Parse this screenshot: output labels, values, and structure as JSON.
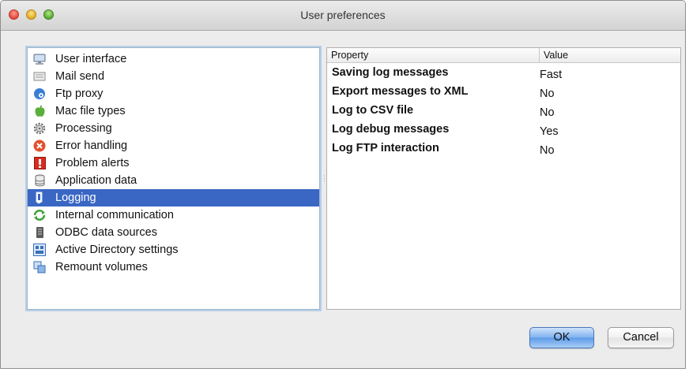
{
  "window": {
    "title": "User preferences"
  },
  "sidebar": {
    "items": [
      {
        "label": "User interface",
        "icon": "monitor-icon"
      },
      {
        "label": "Mail send",
        "icon": "mail-tray-icon"
      },
      {
        "label": "Ftp proxy",
        "icon": "globe-icon"
      },
      {
        "label": "Mac file types",
        "icon": "apple-icon"
      },
      {
        "label": "Processing",
        "icon": "gear-icon"
      },
      {
        "label": "Error handling",
        "icon": "error-icon"
      },
      {
        "label": "Problem alerts",
        "icon": "alert-icon"
      },
      {
        "label": "Application data",
        "icon": "database-icon"
      },
      {
        "label": "Logging",
        "icon": "log-icon",
        "selected": true
      },
      {
        "label": "Internal communication",
        "icon": "sync-icon"
      },
      {
        "label": "ODBC data sources",
        "icon": "odbc-icon"
      },
      {
        "label": "Active Directory settings",
        "icon": "directory-icon"
      },
      {
        "label": "Remount volumes",
        "icon": "remount-icon"
      }
    ]
  },
  "table": {
    "headers": {
      "property": "Property",
      "value": "Value"
    },
    "rows": [
      {
        "property": "Saving log messages",
        "value": "Fast"
      },
      {
        "property": "Export messages to XML",
        "value": "No"
      },
      {
        "property": "Log to CSV file",
        "value": "No"
      },
      {
        "property": "Log debug messages",
        "value": "Yes"
      },
      {
        "property": "Log FTP interaction",
        "value": "No"
      }
    ]
  },
  "buttons": {
    "ok_label": "OK",
    "cancel_label": "Cancel"
  },
  "colors": {
    "selection": "#3a66c4",
    "ok_button": "#5d9be9"
  }
}
